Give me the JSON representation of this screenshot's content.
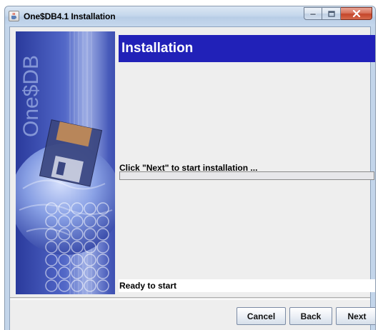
{
  "window": {
    "title": "One$DB4.1 Installation",
    "icons": {
      "app": "java-cup-icon",
      "minimize": "minimize-icon",
      "maximize": "maximize-icon",
      "close": "close-icon"
    }
  },
  "sidebar": {
    "logo_text": "One$DB"
  },
  "header": {
    "title": "Installation",
    "color": "#2121b8"
  },
  "status": {
    "message": "Click \"Next\" to start installation ...",
    "progress": 0
  },
  "status_bar": {
    "text": "Ready to start"
  },
  "buttons": {
    "cancel": "Cancel",
    "back": "Back",
    "next": "Next"
  }
}
